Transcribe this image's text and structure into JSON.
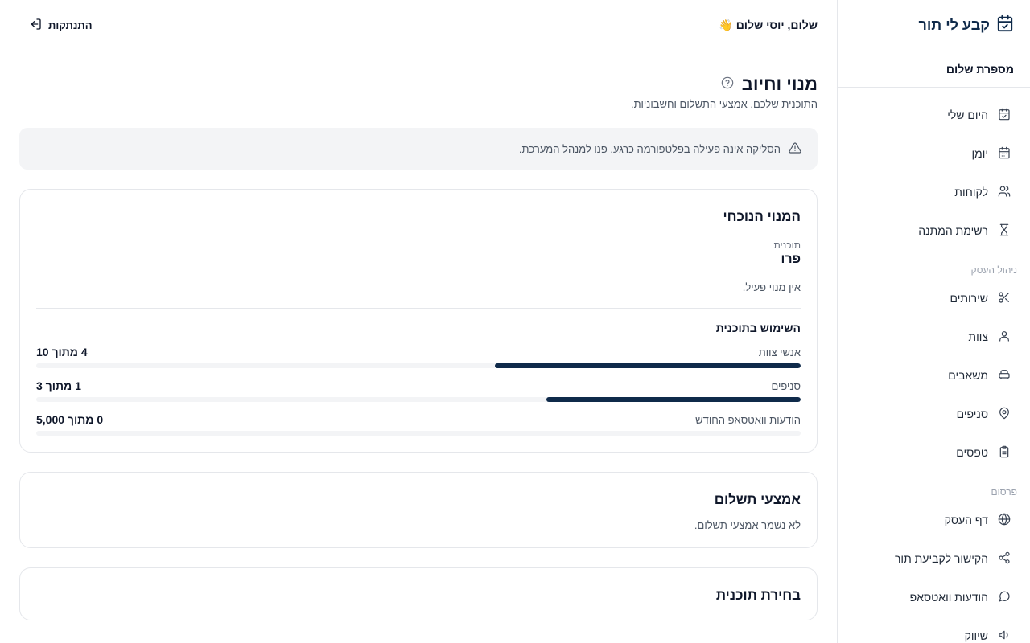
{
  "brand": {
    "name": "קבע לי תור",
    "accent": "#0f2a4a"
  },
  "business_name": "מספרת שלום",
  "nav": {
    "main": [
      {
        "label": "היום שלי",
        "icon": "calendar-check-icon"
      },
      {
        "label": "יומן",
        "icon": "calendar-icon"
      },
      {
        "label": "לקוחות",
        "icon": "users-icon"
      },
      {
        "label": "רשימת המתנה",
        "icon": "hourglass-icon"
      }
    ],
    "section_business": "ניהול העסק",
    "business": [
      {
        "label": "שירותים",
        "icon": "scissors-icon"
      },
      {
        "label": "צוות",
        "icon": "user-icon"
      },
      {
        "label": "משאבים",
        "icon": "armchair-icon"
      },
      {
        "label": "סניפים",
        "icon": "map-pin-icon"
      },
      {
        "label": "טפסים",
        "icon": "clipboard-icon"
      }
    ],
    "section_publish": "פרסום",
    "publish": [
      {
        "label": "דף העסק",
        "icon": "globe-icon"
      },
      {
        "label": "הקישור לקביעת תור",
        "icon": "share-icon"
      },
      {
        "label": "הודעות וואטסאפ",
        "icon": "message-circle-icon"
      },
      {
        "label": "שיווק",
        "icon": "megaphone-icon"
      }
    ]
  },
  "topbar": {
    "greeting": "שלום, יוסי שלום 👋",
    "logout": "התנתקות"
  },
  "page": {
    "title": "מנוי וחיוב",
    "subtitle": "התוכנית שלכם, אמצעי התשלום וחשבוניות."
  },
  "alert": {
    "text": "הסליקה אינה פעילה בפלטפורמה כרגע. פנו למנהל המערכת."
  },
  "current_plan": {
    "title": "המנוי הנוכחי",
    "plan_label": "תוכנית",
    "plan_name": "פרו",
    "status": "אין מנוי פעיל.",
    "usage_title": "השימוש בתוכנית",
    "usage": [
      {
        "label": "אנשי צוות",
        "value": "4 מתוך 10",
        "fraction": 0.4
      },
      {
        "label": "סניפים",
        "value": "1 מתוך 3",
        "fraction": 0.333
      },
      {
        "label": "הודעות וואטסאפ החודש",
        "value": "0 מתוך 5,000",
        "fraction": 0
      }
    ]
  },
  "payment": {
    "title": "אמצעי תשלום",
    "empty": "לא נשמר אמצעי תשלום."
  },
  "choose_plan": {
    "title": "בחירת תוכנית"
  }
}
